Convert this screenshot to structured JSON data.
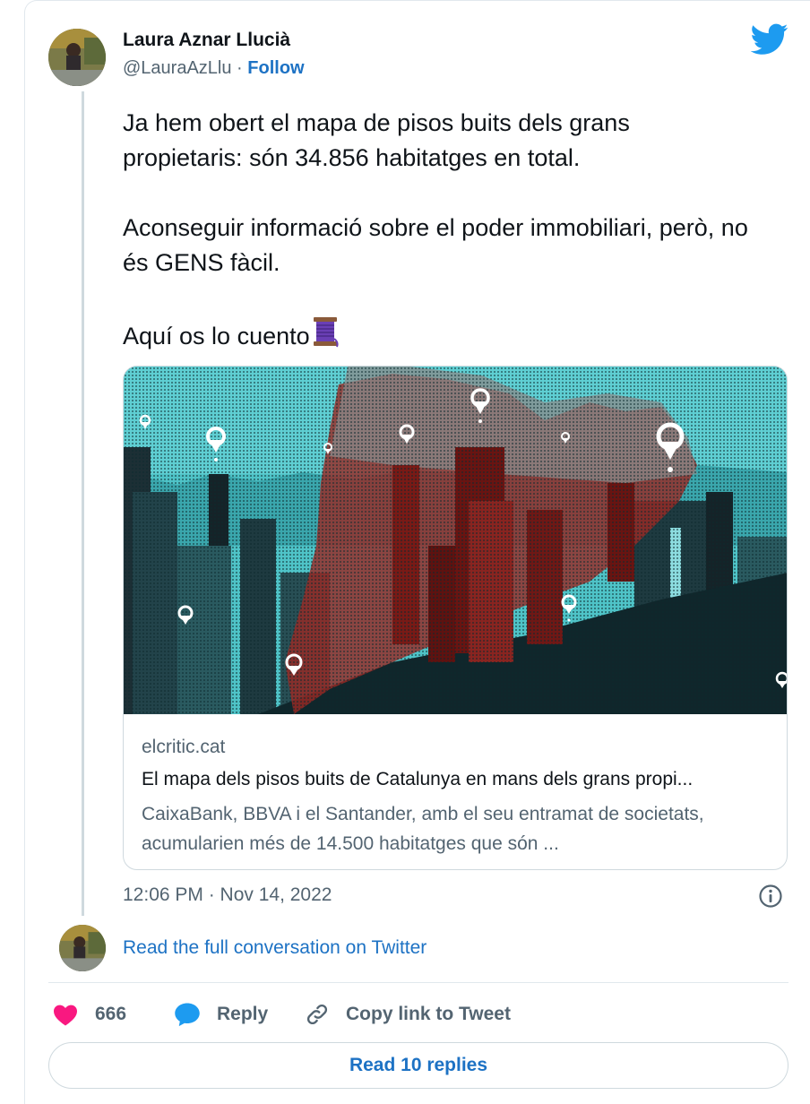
{
  "author": {
    "name": "Laura Aznar Llucià",
    "handle": "@LauraAzLlu",
    "separator": " · ",
    "follow_label": "Follow"
  },
  "tweet": {
    "paragraphs": [
      "Ja hem obert el mapa de pisos buits dels grans propietaris: són 34.856 habitatges en total.",
      "Aconseguir informació sobre el poder immobiliari, però, no és GENS fàcil.",
      "Aquí os lo cuento"
    ],
    "emoji": "thread-spool-icon"
  },
  "link_card": {
    "domain": "elcritic.cat",
    "title": "El mapa dels pisos buits de Catalunya en mans dels grans propi...",
    "description": "CaixaBank, BBVA i el Santander, amb el seu entramat de societats, acumularien més de 14.500 habitatges que són ..."
  },
  "timestamp": "12:06 PM · Nov 14, 2022",
  "read_full_label": "Read the full conversation on Twitter",
  "actions": {
    "likes_count": "666",
    "reply_label": "Reply",
    "copy_link_label": "Copy link to Tweet"
  },
  "read_replies_label": "Read 10 replies",
  "colors": {
    "link_blue": "#1d72c4",
    "twitter_blue": "#1d9bf0",
    "like_pink": "#f91880",
    "muted_text": "#536471"
  }
}
